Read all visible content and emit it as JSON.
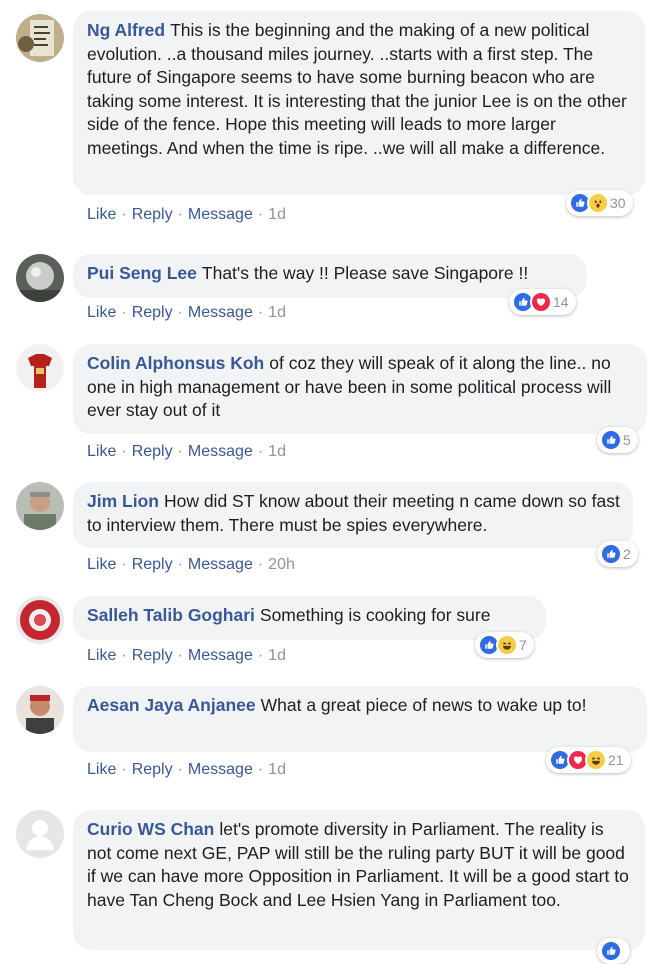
{
  "actions": {
    "like": "Like",
    "reply": "Reply",
    "message": "Message",
    "separator": "·"
  },
  "comments": [
    {
      "author": "Ng Alfred",
      "text": "This is the beginning and the making of a new political evolution. ..a thousand miles journey. ..starts with a first step. The future of Singapore seems to have some burning beacon who are taking some interest. It is interesting that the junior Lee is on the other side of the fence. Hope this meeting will leads to more larger meetings. And when the time is ripe. ..we will all make a difference.",
      "time": "1d",
      "reactions": [
        "like-icon",
        "wow-icon"
      ],
      "reaction_count": "30"
    },
    {
      "author": "Pui Seng Lee",
      "text": "That's the way !! Please save Singapore !!",
      "time": "1d",
      "reactions": [
        "like-icon",
        "love-icon"
      ],
      "reaction_count": "14"
    },
    {
      "author": "Colin Alphonsus Koh",
      "text": "of coz they will speak of it along the line.. no one in high management or have been in some political process will ever stay out of it",
      "time": "1d",
      "reactions": [
        "like-icon"
      ],
      "reaction_count": "5"
    },
    {
      "author": "Jim Lion",
      "text": "How did ST know about their meeting n came down so fast to interview them. There must be spies everywhere.",
      "time": "20h",
      "reactions": [
        "like-icon"
      ],
      "reaction_count": "2"
    },
    {
      "author": "Salleh Talib Goghari",
      "text": "Something is cooking for sure",
      "time": "1d",
      "reactions": [
        "like-icon",
        "haha-icon"
      ],
      "reaction_count": "7"
    },
    {
      "author": "Aesan Jaya Anjanee",
      "text": "What a great piece of news to wake up to!",
      "time": "1d",
      "reactions": [
        "like-icon",
        "love-icon",
        "haha-icon"
      ],
      "reaction_count": "21"
    },
    {
      "author": "Curio WS Chan",
      "text": "let's promote diversity in Parliament. The reality is not come next GE, PAP will still be the ruling party BUT it will be good if we can have more Opposition in Parliament. It will be a good start to have Tan Cheng Bock and Lee Hsien Yang in Parliament too.",
      "time": "",
      "reactions": [
        "like-icon"
      ],
      "reaction_count": ""
    }
  ]
}
